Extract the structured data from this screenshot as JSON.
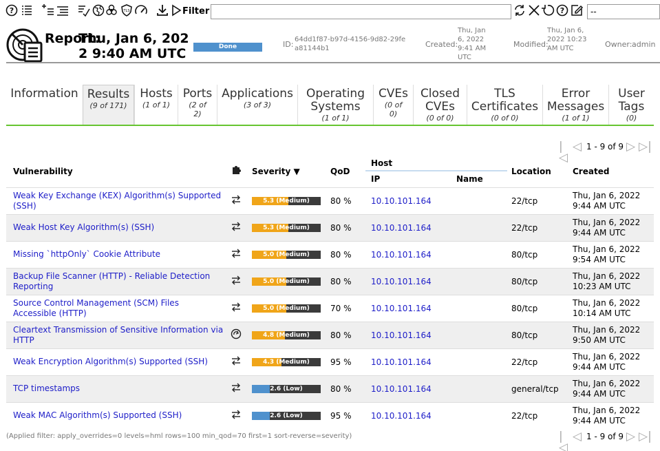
{
  "toolbar": {
    "filter_label": "Filter",
    "filter_value": "",
    "filter_select": "--",
    "icons": [
      "help-icon",
      "list-icon",
      "new-task-icon",
      "details-list-icon",
      "delta-icon",
      "world-icon",
      "biohazard-icon",
      "tls-shield-icon",
      "performance-icon",
      "download-icon",
      "play-icon",
      "refresh-icon",
      "reset-icon",
      "undo-icon",
      "filter-help-icon",
      "edit-filter-icon"
    ]
  },
  "header": {
    "title": "Report:",
    "date": "Thu, Jan 6, 2022 9:40 AM UTC",
    "status": "Done",
    "id_label": "ID:",
    "id_value": "64dd1f87-b97d-4156-9d82-29fea81144b1",
    "created_label": "Created:",
    "created_value": "Thu, Jan 6, 2022 9:41 AM UTC",
    "modified_label": "Modified:",
    "modified_value": "Thu, Jan 6, 2022 10:23 AM UTC",
    "owner_label": "Owner:",
    "owner_value": "admin"
  },
  "tabs": [
    {
      "name": "Information",
      "count": ""
    },
    {
      "name": "Results",
      "count": "(9 of 171)"
    },
    {
      "name": "Hosts",
      "count": "(1 of 1)"
    },
    {
      "name": "Ports",
      "count": "(2 of 2)"
    },
    {
      "name": "Applications",
      "count": "(3 of 3)"
    },
    {
      "name": "Operating Systems",
      "count": "(1 of 1)"
    },
    {
      "name": "CVEs",
      "count": "(0 of 0)"
    },
    {
      "name": "Closed CVEs",
      "count": "(0 of 0)"
    },
    {
      "name": "TLS Certificates",
      "count": "(0 of 0)"
    },
    {
      "name": "Error Messages",
      "count": "(1 of 1)"
    },
    {
      "name": "User Tags",
      "count": "(0)"
    }
  ],
  "pagination": {
    "text": "1 - 9 of 9"
  },
  "table": {
    "headers": {
      "vulnerability": "Vulnerability",
      "severity": "Severity ▼",
      "qod": "QoD",
      "host": "Host",
      "ip": "IP",
      "name": "Name",
      "location": "Location",
      "created": "Created"
    },
    "rows": [
      {
        "vulnerability": "Weak Key Exchange (KEX) Algorithm(s) Supported (SSH)",
        "solution_icon": "vendorfix-icon",
        "severity": 5.3,
        "severity_label": "5.3 (Medium)",
        "qod": "80 %",
        "ip": "10.10.101.164",
        "name": "",
        "location": "22/tcp",
        "created": "Thu, Jan 6, 2022 9:44 AM UTC"
      },
      {
        "vulnerability": "Weak Host Key Algorithm(s) (SSH)",
        "solution_icon": "vendorfix-icon",
        "severity": 5.3,
        "severity_label": "5.3 (Medium)",
        "qod": "80 %",
        "ip": "10.10.101.164",
        "name": "",
        "location": "22/tcp",
        "created": "Thu, Jan 6, 2022 9:44 AM UTC"
      },
      {
        "vulnerability": "Missing `httpOnly` Cookie Attribute",
        "solution_icon": "vendorfix-icon",
        "severity": 5.0,
        "severity_label": "5.0 (Medium)",
        "qod": "80 %",
        "ip": "10.10.101.164",
        "name": "",
        "location": "80/tcp",
        "created": "Thu, Jan 6, 2022 9:54 AM UTC"
      },
      {
        "vulnerability": "Backup File Scanner (HTTP) - Reliable Detection Reporting",
        "solution_icon": "vendorfix-icon",
        "severity": 5.0,
        "severity_label": "5.0 (Medium)",
        "qod": "80 %",
        "ip": "10.10.101.164",
        "name": "",
        "location": "80/tcp",
        "created": "Thu, Jan 6, 2022 10:23 AM UTC"
      },
      {
        "vulnerability": "Source Control Management (SCM) Files Accessible (HTTP)",
        "solution_icon": "vendorfix-icon",
        "severity": 5.0,
        "severity_label": "5.0 (Medium)",
        "qod": "70 %",
        "ip": "10.10.101.164",
        "name": "",
        "location": "80/tcp",
        "created": "Thu, Jan 6, 2022 10:14 AM UTC"
      },
      {
        "vulnerability": "Cleartext Transmission of Sensitive Information via HTTP",
        "solution_icon": "workaround-icon",
        "severity": 4.8,
        "severity_label": "4.8 (Medium)",
        "qod": "80 %",
        "ip": "10.10.101.164",
        "name": "",
        "location": "80/tcp",
        "created": "Thu, Jan 6, 2022 9:50 AM UTC"
      },
      {
        "vulnerability": "Weak Encryption Algorithm(s) Supported (SSH)",
        "solution_icon": "vendorfix-icon",
        "severity": 4.3,
        "severity_label": "4.3 (Medium)",
        "qod": "95 %",
        "ip": "10.10.101.164",
        "name": "",
        "location": "22/tcp",
        "created": "Thu, Jan 6, 2022 9:44 AM UTC"
      },
      {
        "vulnerability": "TCP timestamps",
        "solution_icon": "vendorfix-icon",
        "severity": 2.6,
        "severity_label": "2.6 (Low)",
        "qod": "80 %",
        "ip": "10.10.101.164",
        "name": "",
        "location": "general/tcp",
        "created": "Thu, Jan 6, 2022 9:44 AM UTC"
      },
      {
        "vulnerability": "Weak MAC Algorithm(s) Supported (SSH)",
        "solution_icon": "vendorfix-icon",
        "severity": 2.6,
        "severity_label": "2.6 (Low)",
        "qod": "95 %",
        "ip": "10.10.101.164",
        "name": "",
        "location": "22/tcp",
        "created": "Thu, Jan 6, 2022 9:44 AM UTC"
      }
    ]
  },
  "colors": {
    "medium": "#f0a519",
    "low": "#4f91cd",
    "bar_bg": "#3b3b3b",
    "link": "#1d1dc8",
    "tab_underline": "#66c430"
  },
  "applied_filter": "(Applied filter: apply_overrides=0 levels=hml rows=100 min_qod=70 first=1 sort-reverse=severity)"
}
